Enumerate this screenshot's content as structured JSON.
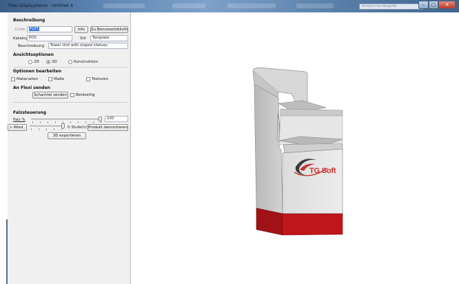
{
  "window": {
    "title": "Flexi DisplayGenie - Untitled 4",
    "search_placeholder": "Einfache Suchbegriffe"
  },
  "beschreibung": {
    "header": "Beschreibung",
    "code_label": "Code",
    "code_value": "FL0T",
    "info_button": "Info",
    "library_button": "Zu Benutzerbibliothe..",
    "katalog_label": "Katalog",
    "katalog_value": "POS",
    "stil_label": "Stil",
    "stil_value": "Template",
    "beschreibung_label": "Beschreibung",
    "beschreibung_value": "Tower Unit with sloped shelves"
  },
  "ansicht": {
    "header": "Ansichtsoptionen",
    "opt_2d": "2D",
    "opt_3d": "3D",
    "opt_konstruktion": "Konstruktion",
    "selected": "3D"
  },
  "optionen": {
    "header": "Optionen bearbeiten",
    "materialien": "Materialien",
    "masse": "Maße",
    "texturen": "Texturen"
  },
  "flexi": {
    "header": "An Flexi senden",
    "send_button": "Schachtel senden",
    "beidseitig": "Beidseitig"
  },
  "falz": {
    "header": "Falzsteuerung",
    "falz_label": "Falz %",
    "falz_value": "100",
    "falz_level": 1.0,
    "wied_button": "> Wied..",
    "stufe_label": "0 Stufe(n)",
    "stufe_level": 1.0,
    "demontieren_button": "Produkt demontieren",
    "export_button": "3D exportieren"
  },
  "viewer": {
    "logo_text": "TG Soft",
    "colors": {
      "body": "#e8e8e8",
      "base": "#c0161b",
      "logo": "#c9312b"
    }
  }
}
